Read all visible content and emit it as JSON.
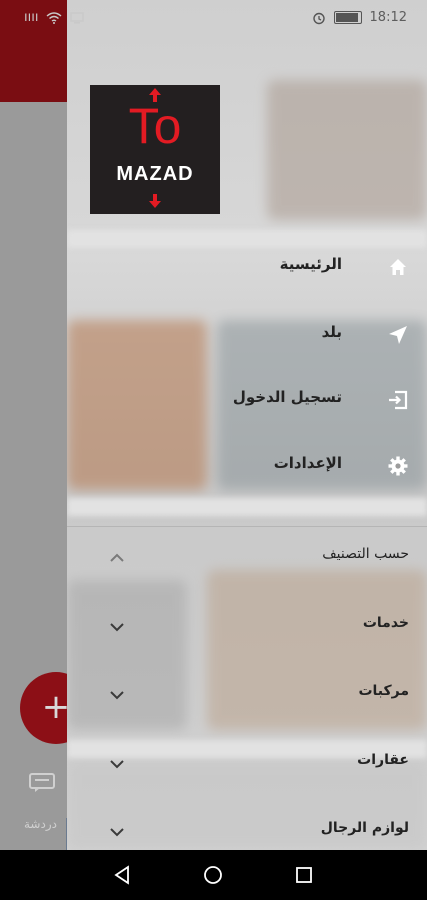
{
  "status_bar": {
    "time": "18:12",
    "left_text": "ıııı"
  },
  "logo": {
    "top_text": "To",
    "bottom_text": "MAZAD"
  },
  "menu": [
    {
      "label": "الرئيسية",
      "icon": "home-icon"
    },
    {
      "label": "بلد",
      "icon": "navigation-arrow-icon"
    },
    {
      "label": "تسجيل الدخول",
      "icon": "login-icon"
    },
    {
      "label": "الإعدادات",
      "icon": "gear-icon"
    }
  ],
  "categories_header": "حسب التصنيف",
  "categories": [
    {
      "label": "خدمات"
    },
    {
      "label": "مركبات"
    },
    {
      "label": "عقارات"
    },
    {
      "label": "لوازم الرجال"
    }
  ],
  "background": {
    "chat_label": "دردشة",
    "fab_symbol": "+"
  },
  "colors": {
    "brand_red": "#e31b23",
    "logo_bg": "#231f20",
    "nav_bar": "#000000"
  }
}
